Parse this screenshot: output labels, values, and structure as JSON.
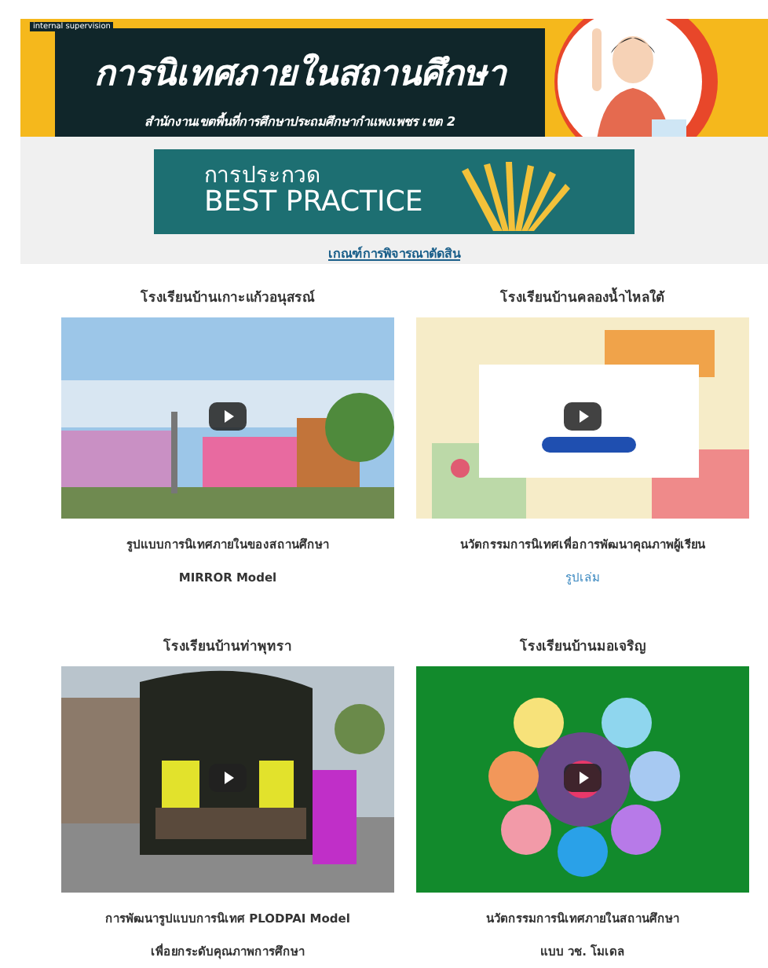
{
  "header": {
    "caption": "internal supervision",
    "title": "การนิเทศภายในสถานศึกษา",
    "subtitle": "สำนักงานเขตพื้นที่การศึกษาประถมศึกษากำแพงเพชร เขต 2"
  },
  "contest_banner": {
    "line_1": "การประกวด",
    "line_2": "BEST PRACTICE"
  },
  "criteria_link": "เกณฑ์การพิจารณาตัดสิน",
  "schools": [
    {
      "name": "โรงเรียนบ้านเกาะแก้วอนุสรณ์",
      "video": {
        "kind": "picture"
      },
      "caption": [
        "รูปแบบการนิเทศภายในของสถานศึกษา",
        "MIRROR Model"
      ]
    },
    {
      "name": "โรงเรียนบ้านคลองน้ำไหลใต้",
      "video": {
        "kind": "picture"
      },
      "caption": [
        "นวัตกรรมการนิเทศเพื่อการพัฒนาคุณภาพผู้เรียน"
      ],
      "link": "รูปเล่ม"
    },
    {
      "name": "โรงเรียนบ้านท่าพุทรา",
      "video": {
        "kind": "picture"
      },
      "caption": [
        "การพัฒนารูปแบบการนิเทศ PLODPAI Model",
        "เพื่อยกระดับคุณภาพการศึกษา"
      ]
    },
    {
      "name": "โรงเรียนบ้านมอเจริญ",
      "video": {
        "kind": "picture"
      },
      "caption": [
        "นวัตกรรมการนิเทศภายในสถานศึกษา",
        "แบบ วช. โมเดล"
      ]
    }
  ]
}
